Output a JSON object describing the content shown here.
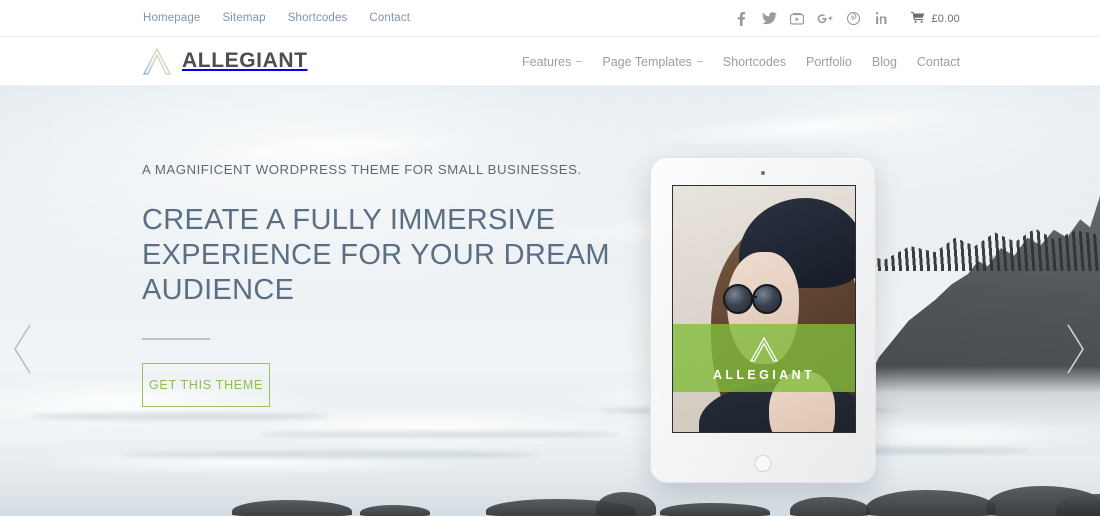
{
  "topbar": {
    "links": [
      {
        "label": "Homepage"
      },
      {
        "label": "Sitemap"
      },
      {
        "label": "Shortcodes"
      },
      {
        "label": "Contact"
      }
    ],
    "social": [
      {
        "name": "facebook-icon",
        "glyph": "f"
      },
      {
        "name": "twitter-icon",
        "glyph": "t"
      },
      {
        "name": "youtube-icon",
        "glyph": "y"
      },
      {
        "name": "google-plus-icon",
        "glyph": "g"
      },
      {
        "name": "pinterest-icon",
        "glyph": "p"
      },
      {
        "name": "linkedin-icon",
        "glyph": "in"
      }
    ],
    "cart": {
      "icon": "shopping-cart-icon",
      "price": "£0.00"
    }
  },
  "header": {
    "logo_icon": "allegiant-a-logo",
    "brand": "ALLEGIANT",
    "nav": [
      {
        "label": "Features",
        "has_dropdown": true
      },
      {
        "label": "Page Templates",
        "has_dropdown": true
      },
      {
        "label": "Shortcodes",
        "has_dropdown": false
      },
      {
        "label": "Portfolio",
        "has_dropdown": false
      },
      {
        "label": "Blog",
        "has_dropdown": false
      },
      {
        "label": "Contact",
        "has_dropdown": false
      }
    ]
  },
  "hero": {
    "kicker": "A MAGNIFICENT WORDPRESS THEME FOR SMALL BUSINESSES.",
    "headline": "CREATE A FULLY IMMERSIVE EXPERIENCE FOR YOUR DREAM AUDIENCE",
    "cta_label": "GET THIS THEME",
    "prev_arrow": "chevron-left-icon",
    "next_arrow": "chevron-right-icon",
    "device": {
      "type": "tablet",
      "overlay_word": "ALLEGIANT",
      "overlay_logo": "allegiant-a-logo"
    }
  },
  "colors": {
    "accent_green": "#8bbf53",
    "topbar_link": "#7d96ad",
    "headline": "#5a6f84",
    "nav_link": "#9a9fa5",
    "brand_text": "#4a4f54",
    "band_green": "#82bd3c"
  }
}
